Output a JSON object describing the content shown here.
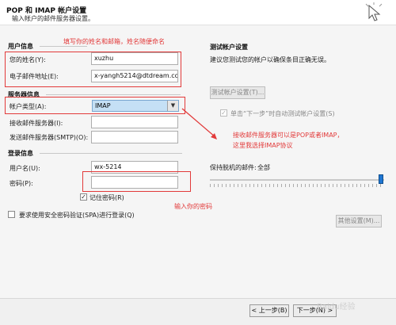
{
  "header": {
    "title": "POP 和 IMAP 帐户设置",
    "subtitle": "输入帐户的邮件服务器设置。"
  },
  "user_info": {
    "section_label": "用户信息",
    "name_label": "您的姓名(Y):",
    "name_value": "xuzhu",
    "email_label": "电子邮件地址(E):",
    "email_value": "x-yangh5214@dtdream.com"
  },
  "server_info": {
    "section_label": "服务器信息",
    "account_type_label": "帐户类型(A):",
    "account_type_value": "IMAP",
    "incoming_label": "接收邮件服务器(I):",
    "incoming_value": "",
    "outgoing_label": "发送邮件服务器(SMTP)(O):",
    "outgoing_value": ""
  },
  "login_info": {
    "section_label": "登录信息",
    "username_label": "用户名(U):",
    "username_value": "wx-5214",
    "password_label": "密码(P):",
    "password_value": "",
    "remember_label": "记住密码(R)",
    "spa_label": "要求使用安全密码验证(SPA)进行登录(Q)"
  },
  "test": {
    "section_label": "测试帐户设置",
    "description": "建议您测试您的帐户以确保条目正确无误。",
    "test_button": "测试帐户设置(T)...",
    "auto_test_label": "单击“下一步”时自动测试帐户设置(S)"
  },
  "offline": {
    "label": "保持脱机的邮件:",
    "value": "全部"
  },
  "more_settings_button": "其他设置(M)...",
  "footer": {
    "back_button": "< 上一步(B)",
    "next_button": "下一步(N) >"
  },
  "annotations": {
    "name_email_note": "填写你的姓名和邮箱，姓名随便命名",
    "server_note_1": "接收邮件服务器可以是POP或者IMAP，",
    "server_note_2": "这里我选择IMAP协议",
    "password_note": "输入你的密码"
  },
  "watermark": "Baidu经验",
  "colors": {
    "annotation_red": "#e23a3a",
    "select_highlight": "#c5e0f5",
    "slider_thumb": "#1f76d2"
  }
}
